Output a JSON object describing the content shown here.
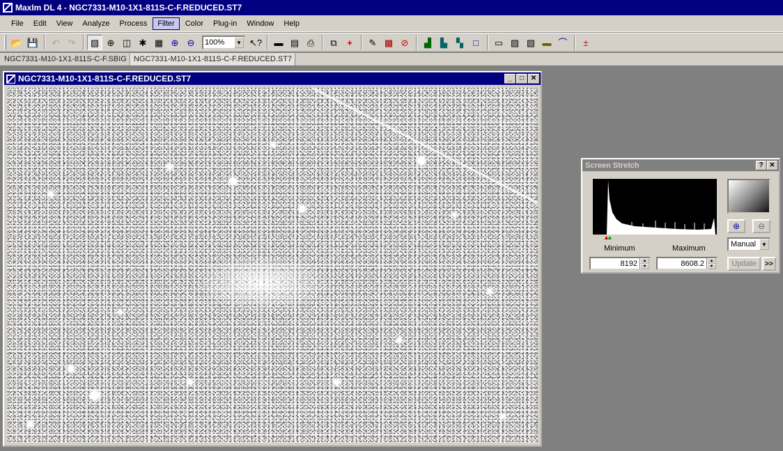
{
  "app": {
    "title": "MaxIm DL 4 - NGC7331-M10-1X1-811S-C-F.REDUCED.ST7"
  },
  "menu": {
    "items": [
      "File",
      "Edit",
      "View",
      "Analyze",
      "Process",
      "Filter",
      "Color",
      "Plug-in",
      "Window",
      "Help"
    ],
    "active": "Filter"
  },
  "toolbar": {
    "zoom_value": "100%",
    "icons": [
      "open-icon",
      "save-icon",
      "undo-icon",
      "redo-icon",
      "image-mode-icon",
      "crosshair-icon",
      "flip-icon",
      "pointer-icon",
      "info-icon",
      "zoom-in-icon",
      "zoom-out-icon",
      "help-pointer-icon",
      "ruler-icon",
      "calculator-icon",
      "print-icon",
      "copy-icon",
      "add-icon",
      "pen-icon",
      "grid-icon",
      "circle-icon",
      "histogram-icon",
      "layers-icon",
      "stack-icon",
      "square-icon",
      "frame-icon",
      "picture-icon",
      "compare-icon",
      "bar-icon",
      "curve-icon",
      "calc-icon"
    ]
  },
  "tabs": {
    "items": [
      "NGC7331-M10-1X1-811S-C-F.SBIG",
      "NGC7331-M10-1X1-811S-C-F.REDUCED.ST7"
    ]
  },
  "image_window": {
    "title": "NGC7331-M10-1X1-811S-C-F.REDUCED.ST7"
  },
  "screen_stretch": {
    "title": "Screen Stretch",
    "minimum_label": "Minimum",
    "maximum_label": "Maximum",
    "minimum_value": "8192",
    "maximum_value": "8608.2",
    "mode": "Manual",
    "update_label": "Update",
    "more_label": ">>"
  },
  "colors": {
    "title_active": "#000080",
    "title_inactive": "#808080",
    "face": "#d4d0c8",
    "workspace": "#808080"
  }
}
